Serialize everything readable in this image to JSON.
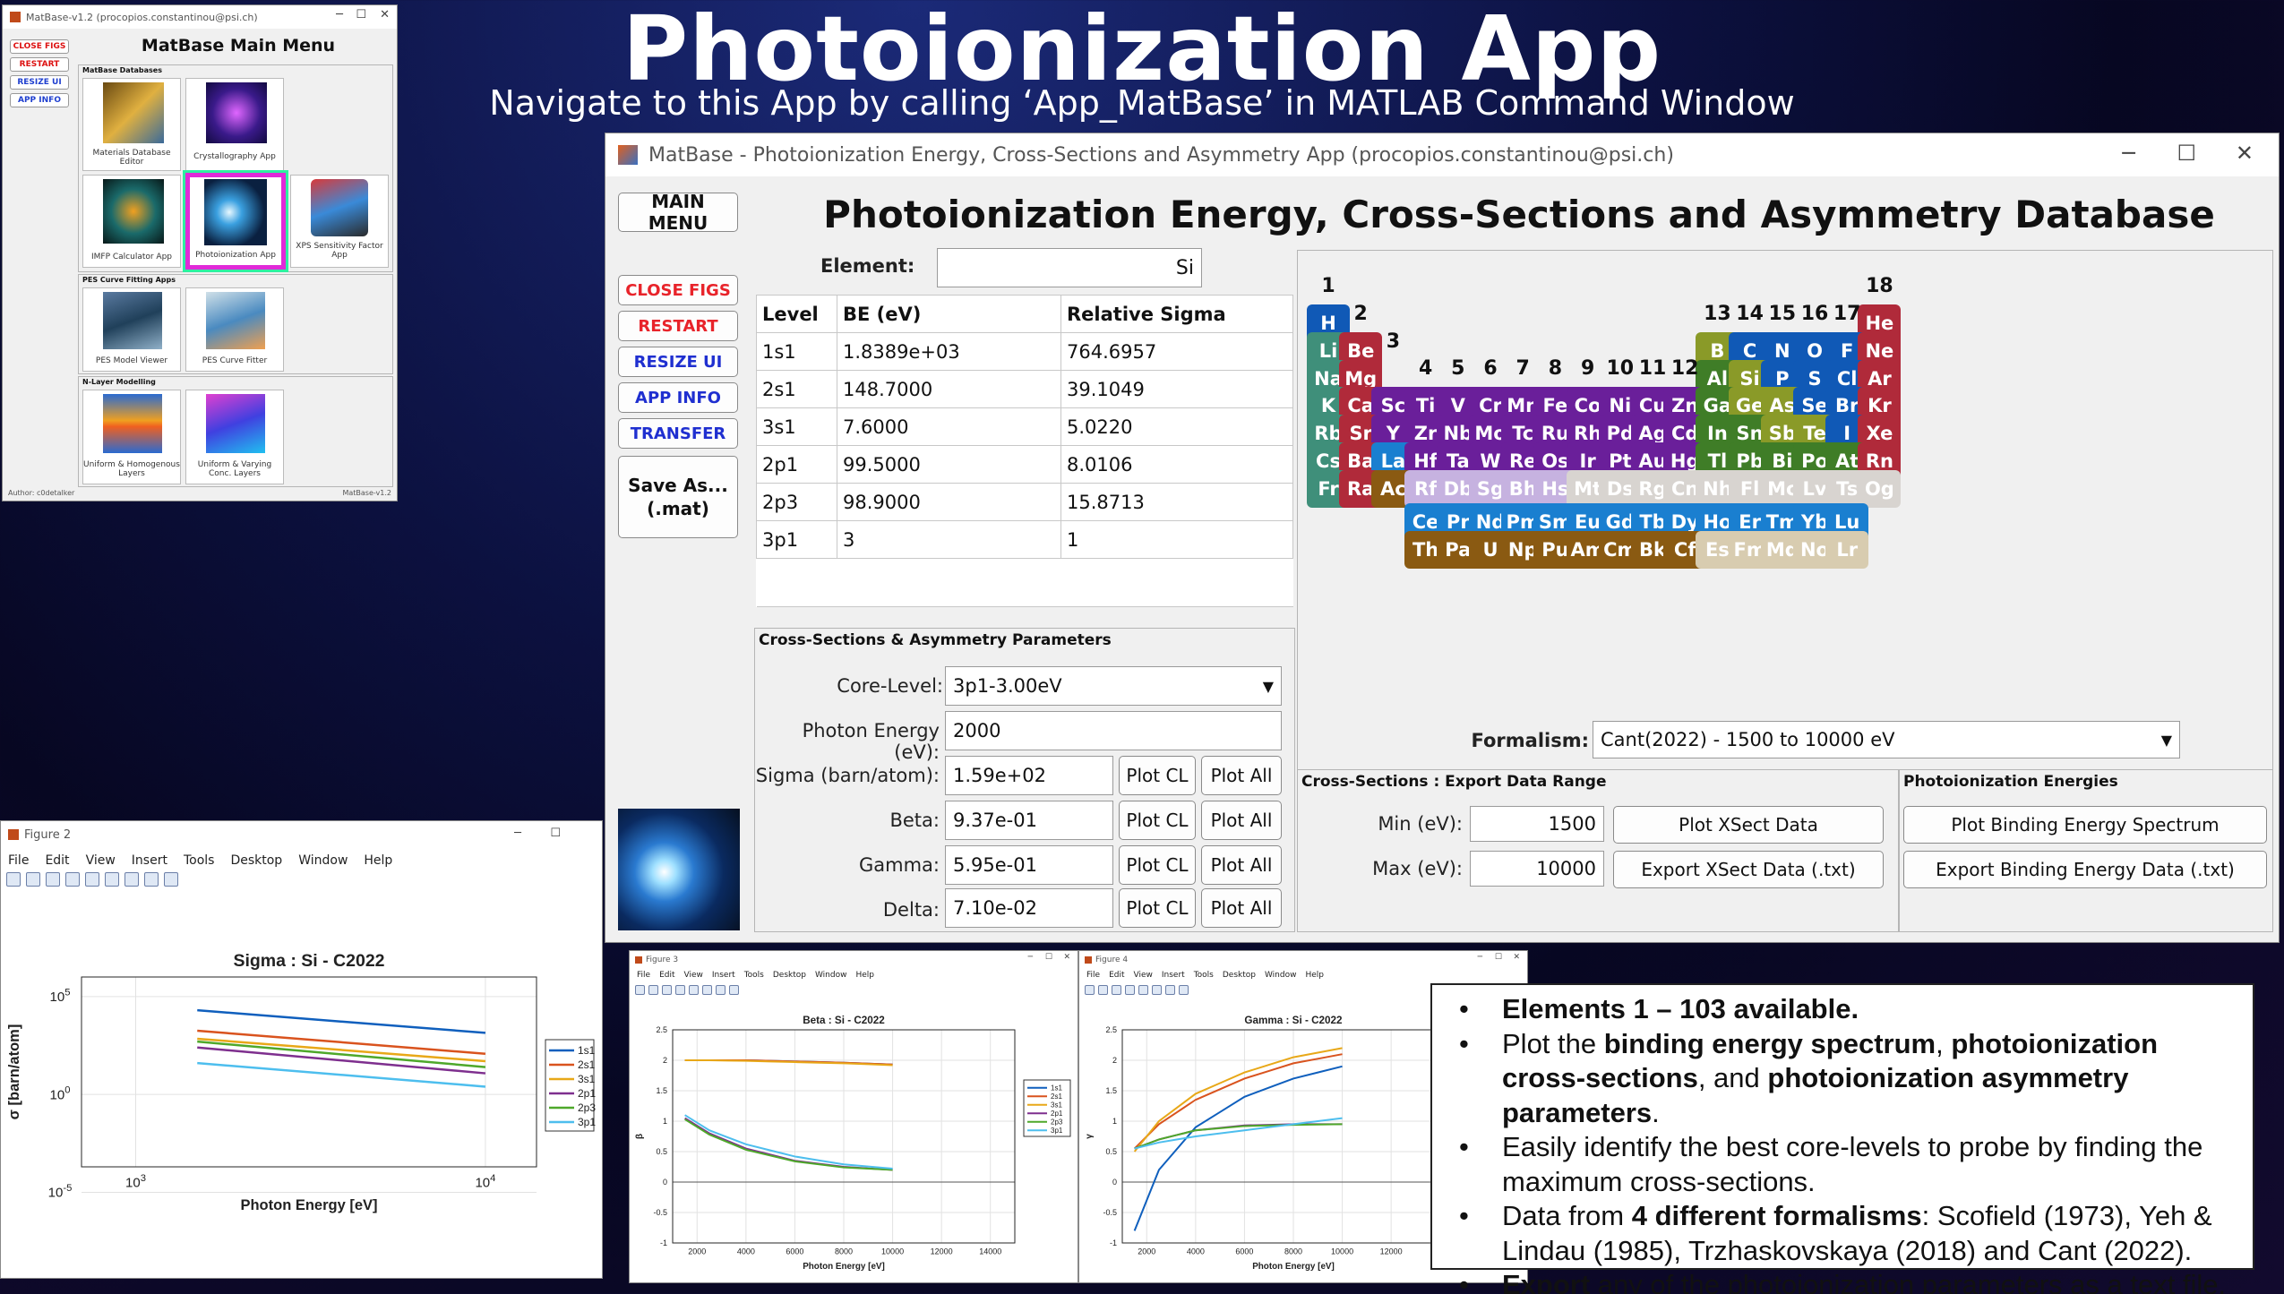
{
  "hero": {
    "title": "Photoionization App",
    "subtitle": "Navigate to this App by calling ‘App_MatBase’ in MATLAB Command Window"
  },
  "main_menu": {
    "window_title": "MatBase-v1.2 (procopios.constantinou@psi.ch)",
    "heading": "MatBase Main Menu",
    "buttons": [
      "CLOSE FIGS",
      "RESTART",
      "RESIZE UI",
      "APP INFO"
    ],
    "sections": [
      {
        "title": "MatBase Databases",
        "items": [
          "Materials Database Editor",
          "Crystallography App",
          "IMFP Calculator App",
          "Photoionization App",
          "XPS Sensitivity Factor App"
        ]
      },
      {
        "title": "PES Curve Fitting Apps",
        "items": [
          "PES Model Viewer",
          "PES Curve Fitter"
        ]
      },
      {
        "title": "N-Layer Modelling",
        "items": [
          "Uniform & Homogenous Layers",
          "Uniform & Varying Conc. Layers"
        ]
      }
    ],
    "footer_left": "Author: c0detalker",
    "footer_right": "MatBase-v1.2"
  },
  "app": {
    "window_title": "MatBase - Photoionization Energy, Cross-Sections and Asymmetry App (procopios.constantinou@psi.ch)",
    "heading": "Photoionization Energy, Cross-Sections and Asymmetry Database",
    "side_buttons": {
      "main_menu": "MAIN MENU",
      "close_figs": "CLOSE FIGS",
      "restart": "RESTART",
      "resize_ui": "RESIZE UI",
      "app_info": "APP INFO",
      "transfer": "TRANSFER",
      "save": "Save As...\n(.mat)"
    },
    "element_label": "Element:",
    "element_value": "Si",
    "table": {
      "headers": [
        "Level",
        "BE (eV)",
        "Relative Sigma"
      ],
      "rows": [
        [
          "1s1",
          "1.8389e+03",
          "764.6957"
        ],
        [
          "2s1",
          "148.7000",
          "39.1049"
        ],
        [
          "3s1",
          "7.6000",
          "5.0220"
        ],
        [
          "2p1",
          "99.5000",
          "8.0106"
        ],
        [
          "2p3",
          "98.9000",
          "15.8713"
        ],
        [
          "3p1",
          "3",
          "1"
        ]
      ]
    },
    "cs_panel": {
      "title": "Cross-Sections & Asymmetry Parameters",
      "core_label": "Core-Level:",
      "core_value": "3p1-3.00eV",
      "photon_label": "Photon Energy (eV):",
      "photon_value": "2000",
      "params": [
        {
          "label": "Sigma (barn/atom):",
          "value": "1.59e+02"
        },
        {
          "label": "Beta:",
          "value": "9.37e-01"
        },
        {
          "label": "Gamma:",
          "value": "5.95e-01"
        },
        {
          "label": "Delta:",
          "value": "7.10e-02"
        }
      ],
      "plot_cl": "Plot CL",
      "plot_all": "Plot All"
    },
    "formalism_label": "Formalism:",
    "formalism_value": "Cant(2022) - 1500 to 10000 eV",
    "export_panel": {
      "title": "Cross-Sections : Export Data Range",
      "min_label": "Min (eV):",
      "min_value": "1500",
      "max_label": "Max (eV):",
      "max_value": "10000",
      "plot_btn": "Plot XSect Data",
      "export_btn": "Export XSect Data (.txt)"
    },
    "pe_panel": {
      "title": "Photoionization Energies",
      "plot_btn": "Plot Binding Energy Spectrum",
      "export_btn": "Export Binding Energy Data (.txt)"
    },
    "group_labels": [
      "1",
      "2",
      "3",
      "4",
      "5",
      "6",
      "7",
      "8",
      "9",
      "10",
      "11",
      "12",
      "13",
      "14",
      "15",
      "16",
      "17",
      "18"
    ],
    "colors": {
      "s_red": "#b02a3a",
      "s_blue": "#1059b6",
      "olive": "#8a9a28",
      "green": "#3f7d27",
      "purple": "#6a1f9a",
      "brown": "#8a5a12",
      "cyan": "#1a7fd0"
    },
    "elements": [
      [
        "H",
        1,
        1,
        "#1059b6"
      ],
      [
        "He",
        18,
        1,
        "#b02a3a"
      ],
      [
        "Li",
        1,
        2,
        "#3f8f7a"
      ],
      [
        "Be",
        2,
        2,
        "#b02a3a"
      ],
      [
        "B",
        13,
        2,
        "#8a9a28"
      ],
      [
        "C",
        14,
        2,
        "#1059b6"
      ],
      [
        "N",
        15,
        2,
        "#1059b6"
      ],
      [
        "O",
        16,
        2,
        "#1059b6"
      ],
      [
        "F",
        17,
        2,
        "#1059b6"
      ],
      [
        "Ne",
        18,
        2,
        "#b02a3a"
      ],
      [
        "Na",
        1,
        3,
        "#3f8f7a"
      ],
      [
        "Mg",
        2,
        3,
        "#b02a3a"
      ],
      [
        "Al",
        13,
        3,
        "#3f7d27"
      ],
      [
        "Si",
        14,
        3,
        "#8a9a28"
      ],
      [
        "P",
        15,
        3,
        "#1059b6"
      ],
      [
        "S",
        16,
        3,
        "#1059b6"
      ],
      [
        "Cl",
        17,
        3,
        "#1059b6"
      ],
      [
        "Ar",
        18,
        3,
        "#b02a3a"
      ],
      [
        "K",
        1,
        4,
        "#3f8f7a"
      ],
      [
        "Ca",
        2,
        4,
        "#b02a3a"
      ],
      [
        "Sc",
        3,
        4,
        "#6a1f9a"
      ],
      [
        "Ti",
        4,
        4,
        "#6a1f9a"
      ],
      [
        "V",
        5,
        4,
        "#6a1f9a"
      ],
      [
        "Cr",
        6,
        4,
        "#6a1f9a"
      ],
      [
        "Mn",
        7,
        4,
        "#6a1f9a"
      ],
      [
        "Fe",
        8,
        4,
        "#6a1f9a"
      ],
      [
        "Co",
        9,
        4,
        "#6a1f9a"
      ],
      [
        "Ni",
        10,
        4,
        "#6a1f9a"
      ],
      [
        "Cu",
        11,
        4,
        "#6a1f9a"
      ],
      [
        "Zn",
        12,
        4,
        "#6a1f9a"
      ],
      [
        "Ga",
        13,
        4,
        "#3f7d27"
      ],
      [
        "Ge",
        14,
        4,
        "#8a9a28"
      ],
      [
        "As",
        15,
        4,
        "#8a9a28"
      ],
      [
        "Se",
        16,
        4,
        "#1059b6"
      ],
      [
        "Br",
        17,
        4,
        "#1059b6"
      ],
      [
        "Kr",
        18,
        4,
        "#b02a3a"
      ],
      [
        "Rb",
        1,
        5,
        "#3f8f7a"
      ],
      [
        "Sr",
        2,
        5,
        "#b02a3a"
      ],
      [
        "Y",
        3,
        5,
        "#6a1f9a"
      ],
      [
        "Zr",
        4,
        5,
        "#6a1f9a"
      ],
      [
        "Nb",
        5,
        5,
        "#6a1f9a"
      ],
      [
        "Mo",
        6,
        5,
        "#6a1f9a"
      ],
      [
        "Tc",
        7,
        5,
        "#6a1f9a"
      ],
      [
        "Ru",
        8,
        5,
        "#6a1f9a"
      ],
      [
        "Rh",
        9,
        5,
        "#6a1f9a"
      ],
      [
        "Pd",
        10,
        5,
        "#6a1f9a"
      ],
      [
        "Ag",
        11,
        5,
        "#6a1f9a"
      ],
      [
        "Cd",
        12,
        5,
        "#6a1f9a"
      ],
      [
        "In",
        13,
        5,
        "#3f7d27"
      ],
      [
        "Sn",
        14,
        5,
        "#3f7d27"
      ],
      [
        "Sb",
        15,
        5,
        "#8a9a28"
      ],
      [
        "Te",
        16,
        5,
        "#8a9a28"
      ],
      [
        "I",
        17,
        5,
        "#1059b6"
      ],
      [
        "Xe",
        18,
        5,
        "#b02a3a"
      ],
      [
        "Cs",
        1,
        6,
        "#3f8f7a"
      ],
      [
        "Ba",
        2,
        6,
        "#b02a3a"
      ],
      [
        "La",
        3,
        6,
        "#1a7fd0"
      ],
      [
        "Hf",
        4,
        6,
        "#6a1f9a"
      ],
      [
        "Ta",
        5,
        6,
        "#6a1f9a"
      ],
      [
        "W",
        6,
        6,
        "#6a1f9a"
      ],
      [
        "Re",
        7,
        6,
        "#6a1f9a"
      ],
      [
        "Os",
        8,
        6,
        "#6a1f9a"
      ],
      [
        "Ir",
        9,
        6,
        "#6a1f9a"
      ],
      [
        "Pt",
        10,
        6,
        "#6a1f9a"
      ],
      [
        "Au",
        11,
        6,
        "#6a1f9a"
      ],
      [
        "Hg",
        12,
        6,
        "#6a1f9a"
      ],
      [
        "Tl",
        13,
        6,
        "#3f7d27"
      ],
      [
        "Pb",
        14,
        6,
        "#3f7d27"
      ],
      [
        "Bi",
        15,
        6,
        "#3f7d27"
      ],
      [
        "Po",
        16,
        6,
        "#3f7d27"
      ],
      [
        "At",
        17,
        6,
        "#3f7d27"
      ],
      [
        "Rn",
        18,
        6,
        "#b02a3a"
      ],
      [
        "Fr",
        1,
        7,
        "#3f8f7a"
      ],
      [
        "Ra",
        2,
        7,
        "#b02a3a"
      ],
      [
        "Ac",
        3,
        7,
        "#8a5a12"
      ],
      [
        "Rf",
        4,
        7,
        "#c6b2e0"
      ],
      [
        "Db",
        5,
        7,
        "#c6b2e0"
      ],
      [
        "Sg",
        6,
        7,
        "#c6b2e0"
      ],
      [
        "Bh",
        7,
        7,
        "#c6b2e0"
      ],
      [
        "Hs",
        8,
        7,
        "#c6b2e0"
      ],
      [
        "Mt",
        9,
        7,
        "#d8d4d0"
      ],
      [
        "Ds",
        10,
        7,
        "#d8d4d0"
      ],
      [
        "Rg",
        11,
        7,
        "#d8d4d0"
      ],
      [
        "Cn",
        12,
        7,
        "#d8d4d0"
      ],
      [
        "Nh",
        13,
        7,
        "#d8d4d0"
      ],
      [
        "Fl",
        14,
        7,
        "#d8d4d0"
      ],
      [
        "Mc",
        15,
        7,
        "#d8d4d0"
      ],
      [
        "Lv",
        16,
        7,
        "#d8d4d0"
      ],
      [
        "Ts",
        17,
        7,
        "#d8d4d0"
      ],
      [
        "Og",
        18,
        7,
        "#d8d4d0"
      ],
      [
        "Ce",
        4,
        8.2,
        "#1a7fd0"
      ],
      [
        "Pr",
        5,
        8.2,
        "#1a7fd0"
      ],
      [
        "Nd",
        6,
        8.2,
        "#1a7fd0"
      ],
      [
        "Pm",
        7,
        8.2,
        "#1a7fd0"
      ],
      [
        "Sm",
        8,
        8.2,
        "#1a7fd0"
      ],
      [
        "Eu",
        9,
        8.2,
        "#1a7fd0"
      ],
      [
        "Gd",
        10,
        8.2,
        "#1a7fd0"
      ],
      [
        "Tb",
        11,
        8.2,
        "#1a7fd0"
      ],
      [
        "Dy",
        12,
        8.2,
        "#1a7fd0"
      ],
      [
        "Ho",
        13,
        8.2,
        "#1a7fd0"
      ],
      [
        "Er",
        14,
        8.2,
        "#1a7fd0"
      ],
      [
        "Tm",
        15,
        8.2,
        "#1a7fd0"
      ],
      [
        "Yb",
        16,
        8.2,
        "#1a7fd0"
      ],
      [
        "Lu",
        17,
        8.2,
        "#1a7fd0"
      ],
      [
        "Th",
        4,
        9.2,
        "#8a5a12"
      ],
      [
        "Pa",
        5,
        9.2,
        "#8a5a12"
      ],
      [
        "U",
        6,
        9.2,
        "#8a5a12"
      ],
      [
        "Np",
        7,
        9.2,
        "#8a5a12"
      ],
      [
        "Pu",
        8,
        9.2,
        "#8a5a12"
      ],
      [
        "Am",
        9,
        9.2,
        "#8a5a12"
      ],
      [
        "Cm",
        10,
        9.2,
        "#8a5a12"
      ],
      [
        "Bk",
        11,
        9.2,
        "#8a5a12"
      ],
      [
        "Cf",
        12,
        9.2,
        "#8a5a12"
      ],
      [
        "Es",
        13,
        9.2,
        "#d8ccb0"
      ],
      [
        "Fm",
        14,
        9.2,
        "#d8ccb0"
      ],
      [
        "Md",
        15,
        9.2,
        "#d8ccb0"
      ],
      [
        "No",
        16,
        9.2,
        "#d8ccb0"
      ],
      [
        "Lr",
        17,
        9.2,
        "#d8ccb0"
      ]
    ]
  },
  "fig2": {
    "window_title": "Figure 2",
    "menu": [
      "File",
      "Edit",
      "View",
      "Insert",
      "Tools",
      "Desktop",
      "Window",
      "Help"
    ]
  },
  "fig3": {
    "window_title": "Figure 3",
    "menu": [
      "File",
      "Edit",
      "View",
      "Insert",
      "Tools",
      "Desktop",
      "Window",
      "Help"
    ]
  },
  "fig4": {
    "window_title": "Figure 4",
    "menu": [
      "File",
      "Edit",
      "View",
      "Insert",
      "Tools",
      "Desktop",
      "Window",
      "Help"
    ]
  },
  "chart_data": [
    {
      "type": "line",
      "title": "Sigma : Si - C2022",
      "xlabel": "Photon Energy [eV]",
      "ylabel": "σ [barn/atom]",
      "xscale": "log",
      "yscale": "log",
      "xlim": [
        700,
        14000
      ],
      "ylim": [
        0.0002,
        1000000
      ],
      "xticks": [
        "10^3",
        "10^4"
      ],
      "yticks": [
        "10^5",
        "10^0",
        "10^-5"
      ],
      "grid": true,
      "legend": "right",
      "x": [
        1500,
        10000
      ],
      "series": [
        {
          "name": "1s1",
          "color": "#0f5fbd",
          "values": [
            20000,
            1400
          ]
        },
        {
          "name": "2s1",
          "color": "#d9531e",
          "values": [
            1800,
            120
          ]
        },
        {
          "name": "3s1",
          "color": "#e8a818",
          "values": [
            700,
            50
          ]
        },
        {
          "name": "2p1",
          "color": "#7e2f8e",
          "values": [
            250,
            12
          ]
        },
        {
          "name": "2p3",
          "color": "#4ea82a",
          "values": [
            500,
            25
          ]
        },
        {
          "name": "3p1",
          "color": "#4dbeee",
          "values": [
            40,
            2.5
          ]
        }
      ]
    },
    {
      "type": "line",
      "title": "Beta : Si - C2022",
      "xlabel": "Photon Energy [eV]",
      "ylabel": "β",
      "xlim": [
        1000,
        15000
      ],
      "ylim": [
        -1,
        2.5
      ],
      "xticks": [
        "2000",
        "4000",
        "6000",
        "8000",
        "10000",
        "12000",
        "14000"
      ],
      "yticks": [
        "-1",
        "-0.5",
        "0",
        "0.5",
        "1",
        "1.5",
        "2",
        "2.5"
      ],
      "grid": true,
      "legend": "right",
      "x": [
        1500,
        2500,
        4000,
        6000,
        8000,
        10000
      ],
      "series": [
        {
          "name": "1s1",
          "color": "#0f5fbd",
          "values": [
            2,
            2,
            2,
            1.98,
            1.96,
            1.93
          ]
        },
        {
          "name": "2s1",
          "color": "#d9531e",
          "values": [
            2,
            2,
            2,
            1.98,
            1.96,
            1.93
          ]
        },
        {
          "name": "3s1",
          "color": "#e8a818",
          "values": [
            2,
            2,
            1.99,
            1.97,
            1.95,
            1.92
          ]
        },
        {
          "name": "2p1",
          "color": "#7e2f8e",
          "values": [
            1.05,
            0.8,
            0.55,
            0.35,
            0.25,
            0.2
          ]
        },
        {
          "name": "2p3",
          "color": "#4ea82a",
          "values": [
            1.03,
            0.78,
            0.53,
            0.34,
            0.24,
            0.2
          ]
        },
        {
          "name": "3p1",
          "color": "#4dbeee",
          "values": [
            1.1,
            0.85,
            0.62,
            0.42,
            0.29,
            0.22
          ]
        }
      ]
    },
    {
      "type": "line",
      "title": "Gamma : Si - C2022",
      "xlabel": "Photon Energy [eV]",
      "ylabel": "γ",
      "xlim": [
        1000,
        15000
      ],
      "ylim": [
        -1,
        2.5
      ],
      "xticks": [
        "2000",
        "4000",
        "6000",
        "8000",
        "10000",
        "12000"
      ],
      "yticks": [
        "-1",
        "-0.5",
        "0",
        "0.5",
        "1",
        "1.5",
        "2",
        "2.5"
      ],
      "grid": true,
      "x": [
        1500,
        2500,
        4000,
        6000,
        8000,
        10000
      ],
      "series": [
        {
          "name": "1s1",
          "color": "#0f5fbd",
          "values": [
            -0.8,
            0.2,
            0.9,
            1.4,
            1.7,
            1.9
          ]
        },
        {
          "name": "2s1",
          "color": "#d9531e",
          "values": [
            0.55,
            0.95,
            1.35,
            1.7,
            1.95,
            2.1
          ]
        },
        {
          "name": "3s1",
          "color": "#e8a818",
          "values": [
            0.5,
            1.0,
            1.45,
            1.8,
            2.05,
            2.2
          ]
        },
        {
          "name": "2p1",
          "color": "#7e2f8e",
          "values": [
            0.55,
            0.7,
            0.85,
            0.93,
            0.95,
            0.95
          ]
        },
        {
          "name": "2p3",
          "color": "#4ea82a",
          "values": [
            0.55,
            0.7,
            0.85,
            0.92,
            0.94,
            0.95
          ]
        },
        {
          "name": "3p1",
          "color": "#4dbeee",
          "values": [
            0.55,
            0.65,
            0.75,
            0.85,
            0.95,
            1.05
          ]
        }
      ]
    }
  ],
  "bullets": [
    {
      "parts": [
        [
          "b",
          "Elements 1 – 103 available."
        ]
      ]
    },
    {
      "parts": [
        [
          "n",
          "Plot the "
        ],
        [
          "b",
          "binding energy spectrum"
        ],
        [
          "n",
          ", "
        ],
        [
          "b",
          "photoionization cross-sections"
        ],
        [
          "n",
          ", and "
        ],
        [
          "b",
          "photoionization asymmetry parameters"
        ],
        [
          "n",
          "."
        ]
      ]
    },
    {
      "parts": [
        [
          "n",
          "Easily identify the best core-levels to probe by finding the maximum cross-sections."
        ]
      ]
    },
    {
      "parts": [
        [
          "n",
          "Data from "
        ],
        [
          "b",
          "4 different formalisms"
        ],
        [
          "n",
          ": Scofield (1973), Yeh & Lindau (1985), Trzhaskovskaya (2018) and Cant (2022)."
        ]
      ]
    },
    {
      "parts": [
        [
          "b",
          "Export"
        ],
        [
          "n",
          " any of the photoionization parameters as a text file."
        ]
      ]
    }
  ]
}
